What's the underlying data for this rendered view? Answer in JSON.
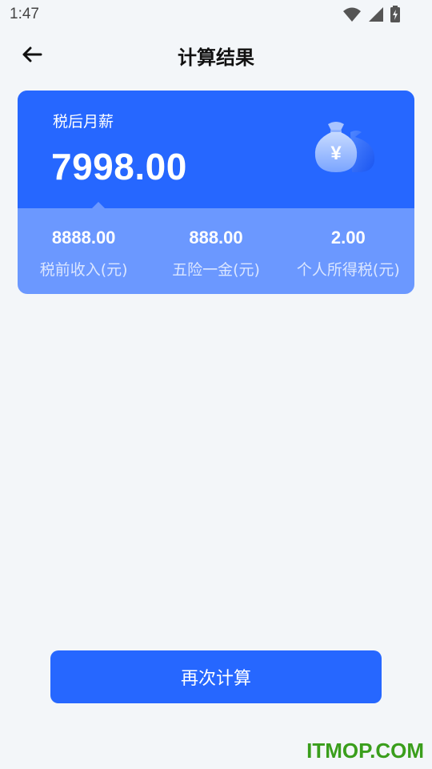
{
  "status_bar": {
    "time": "1:47",
    "icons": [
      "wifi-icon",
      "signal-icon",
      "battery-charging-icon"
    ]
  },
  "header": {
    "back_icon": "arrow-left-icon",
    "title": "计算结果"
  },
  "result": {
    "after_tax_label": "税后月薪",
    "after_tax_value": "7998.00",
    "icon": "money-bag-icon",
    "stats": [
      {
        "value": "8888.00",
        "label": "税前收入(元)"
      },
      {
        "value": "888.00",
        "label": "五险一金(元)"
      },
      {
        "value": "2.00",
        "label": "个人所得税(元)"
      }
    ]
  },
  "recalc_button": {
    "label": "再次计算"
  },
  "watermark": {
    "text": "ITMOP.COM"
  },
  "colors": {
    "primary": "#2667ff",
    "card_bottom": "#6b98ff",
    "background": "#f3f6f9",
    "watermark": "#3a9e1c"
  }
}
